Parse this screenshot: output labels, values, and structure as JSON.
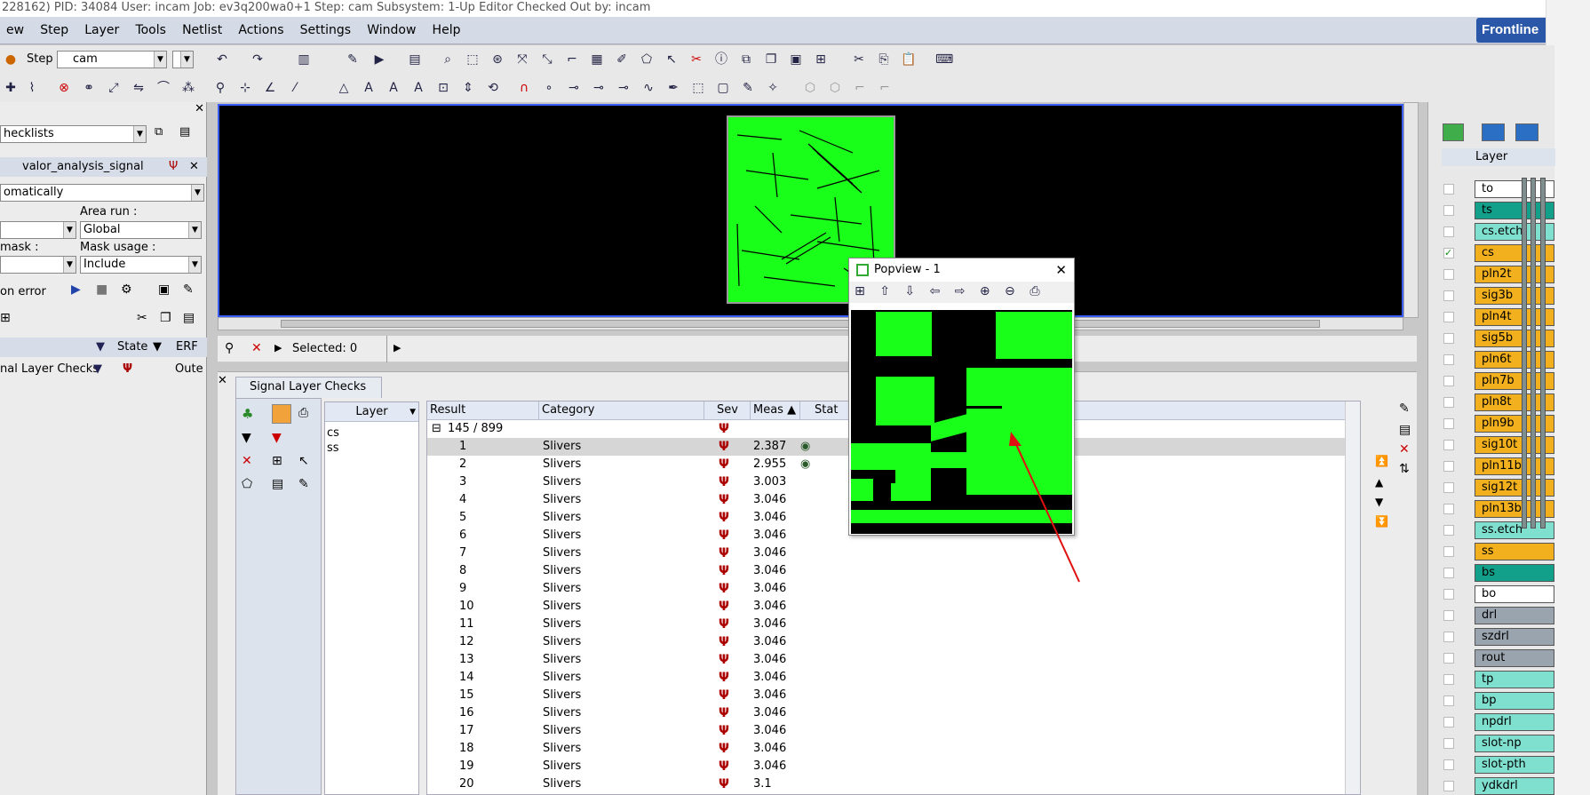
{
  "window": {
    "title_text": "228162)  PID: 34084  User: incam  Job: ev3q200wa0+1  Step: cam  Subsystem: 1-Up Editor   Checked Out by: incam"
  },
  "brand": "Frontline",
  "menu": [
    "ew",
    "Step",
    "Layer",
    "Tools",
    "Netlist",
    "Actions",
    "Settings",
    "Window",
    "Help"
  ],
  "toolbar": {
    "step_label": "Step",
    "step_value": "cam"
  },
  "left": {
    "checklists": "hecklists",
    "analysis": "valor_analysis_signal",
    "mode": "omatically",
    "area_run_label": "Area run :",
    "area_run_value": "Global",
    "mask_label": "mask :",
    "mask_usage_label": "Mask usage :",
    "mask_usage_value": "Include",
    "on_error": "on error",
    "state": "State",
    "erf": "ERF",
    "check_row": "nal Layer Checks",
    "outer": "Oute"
  },
  "selbar": {
    "selected": "Selected: 0"
  },
  "checks": {
    "tab": "Signal Layer Checks",
    "layer_header": "Layer",
    "layers": [
      "cs",
      "ss"
    ],
    "columns": {
      "result": "Result",
      "category": "Category",
      "sev": "Sev",
      "meas": "Meas",
      "stat": "Stat"
    },
    "group": "145 / 899",
    "rows": [
      {
        "n": "1",
        "cat": "Slivers",
        "meas": "2.387",
        "eye": true
      },
      {
        "n": "2",
        "cat": "Slivers",
        "meas": "2.955",
        "eye": true
      },
      {
        "n": "3",
        "cat": "Slivers",
        "meas": "3.003"
      },
      {
        "n": "4",
        "cat": "Slivers",
        "meas": "3.046"
      },
      {
        "n": "5",
        "cat": "Slivers",
        "meas": "3.046"
      },
      {
        "n": "6",
        "cat": "Slivers",
        "meas": "3.046"
      },
      {
        "n": "7",
        "cat": "Slivers",
        "meas": "3.046"
      },
      {
        "n": "8",
        "cat": "Slivers",
        "meas": "3.046"
      },
      {
        "n": "9",
        "cat": "Slivers",
        "meas": "3.046"
      },
      {
        "n": "10",
        "cat": "Slivers",
        "meas": "3.046"
      },
      {
        "n": "11",
        "cat": "Slivers",
        "meas": "3.046"
      },
      {
        "n": "12",
        "cat": "Slivers",
        "meas": "3.046"
      },
      {
        "n": "13",
        "cat": "Slivers",
        "meas": "3.046"
      },
      {
        "n": "14",
        "cat": "Slivers",
        "meas": "3.046"
      },
      {
        "n": "15",
        "cat": "Slivers",
        "meas": "3.046"
      },
      {
        "n": "16",
        "cat": "Slivers",
        "meas": "3.046"
      },
      {
        "n": "17",
        "cat": "Slivers",
        "meas": "3.046"
      },
      {
        "n": "18",
        "cat": "Slivers",
        "meas": "3.046"
      },
      {
        "n": "19",
        "cat": "Slivers",
        "meas": "3.046"
      },
      {
        "n": "20",
        "cat": "Slivers",
        "meas": "3.1"
      }
    ]
  },
  "popview": {
    "title": "Popview - 1"
  },
  "layers_panel": {
    "header": "Layer",
    "items": [
      {
        "name": "to",
        "style": "w"
      },
      {
        "name": "ts",
        "style": "t"
      },
      {
        "name": "cs.etch",
        "style": "c"
      },
      {
        "name": "cs",
        "style": "o",
        "active": true
      },
      {
        "name": "pln2t",
        "style": "o"
      },
      {
        "name": "sig3b",
        "style": "o"
      },
      {
        "name": "pln4t",
        "style": "o"
      },
      {
        "name": "sig5b",
        "style": "o"
      },
      {
        "name": "pln6t",
        "style": "o"
      },
      {
        "name": "pln7b",
        "style": "o"
      },
      {
        "name": "pln8t",
        "style": "o"
      },
      {
        "name": "pln9b",
        "style": "o"
      },
      {
        "name": "sig10t",
        "style": "o"
      },
      {
        "name": "pln11b",
        "style": "o"
      },
      {
        "name": "sig12t",
        "style": "o"
      },
      {
        "name": "pln13b",
        "style": "o"
      },
      {
        "name": "ss.etch",
        "style": "c"
      },
      {
        "name": "ss",
        "style": "o"
      },
      {
        "name": "bs",
        "style": "t"
      },
      {
        "name": "bo",
        "style": "w"
      },
      {
        "name": "drl",
        "style": "gr"
      },
      {
        "name": "szdrl",
        "style": "gr"
      },
      {
        "name": "rout",
        "style": "gr"
      },
      {
        "name": "tp",
        "style": "c"
      },
      {
        "name": "bp",
        "style": "c"
      },
      {
        "name": "npdrl",
        "style": "c"
      },
      {
        "name": "slot-np",
        "style": "c"
      },
      {
        "name": "slot-pth",
        "style": "c"
      },
      {
        "name": "ydkdrl",
        "style": "c"
      }
    ]
  }
}
